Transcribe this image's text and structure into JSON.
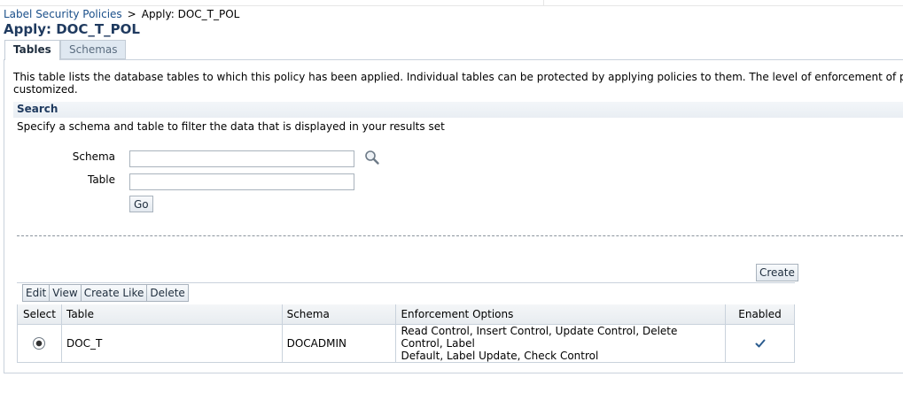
{
  "breadcrumb": {
    "parent": "Label Security Policies",
    "separator": ">",
    "current": "Apply: DOC_T_POL"
  },
  "page_title": "Apply: DOC_T_POL",
  "tabs": [
    {
      "label": "Tables",
      "active": true
    },
    {
      "label": "Schemas",
      "active": false
    }
  ],
  "description": {
    "line1": "This table lists the database tables to which this policy has been applied. Individual tables can be protected by applying policies to them. The level of enforcement of policy for each table c",
    "line2": "customized."
  },
  "search": {
    "title": "Search",
    "help": "Specify a schema and table to filter the data that is displayed in your results set",
    "schema_label": "Schema",
    "schema_value": "",
    "table_label": "Table",
    "table_value": "",
    "go_label": "Go"
  },
  "actions": {
    "create_label": "Create",
    "edit_label": "Edit",
    "view_label": "View",
    "create_like_label": "Create Like",
    "delete_label": "Delete"
  },
  "results": {
    "columns": [
      "Select",
      "Table",
      "Schema",
      "Enforcement Options",
      "Enabled"
    ],
    "rows": [
      {
        "selected": true,
        "table": "DOC_T",
        "schema": "DOCADMIN",
        "enforcement_line1": "Read Control, Insert Control, Update Control, Delete Control, Label",
        "enforcement_line2": "Default, Label Update, Check Control",
        "enabled": true
      }
    ]
  },
  "colors": {
    "link": "#1a4f8a",
    "title": "#1f3a5f",
    "check": "#2b5c8f"
  }
}
